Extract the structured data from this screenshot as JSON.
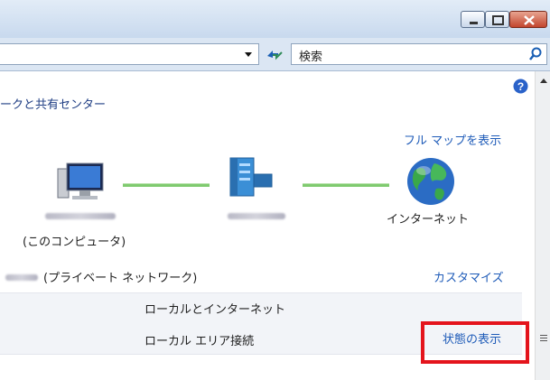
{
  "window": {
    "controls": {
      "minimize": "minimize",
      "maximize": "maximize",
      "close": "close"
    }
  },
  "toolbar": {
    "search_placeholder": "検索"
  },
  "content": {
    "breadcrumb_title": "ークと共有センター",
    "full_map_link": "フル マップを表示",
    "computer_label": "(このコンピュータ)",
    "internet_label": "インターネット",
    "network_type_label": "(プライベート ネットワーク)",
    "customize_link": "カスタマイズ",
    "access_type": "ローカルとインターネット",
    "connection": "ローカル エリア接続",
    "status_link": "状態の表示"
  },
  "colors": {
    "link": "#1e5bb8",
    "highlight": "#e4141c",
    "connector": "#7fca6f"
  }
}
